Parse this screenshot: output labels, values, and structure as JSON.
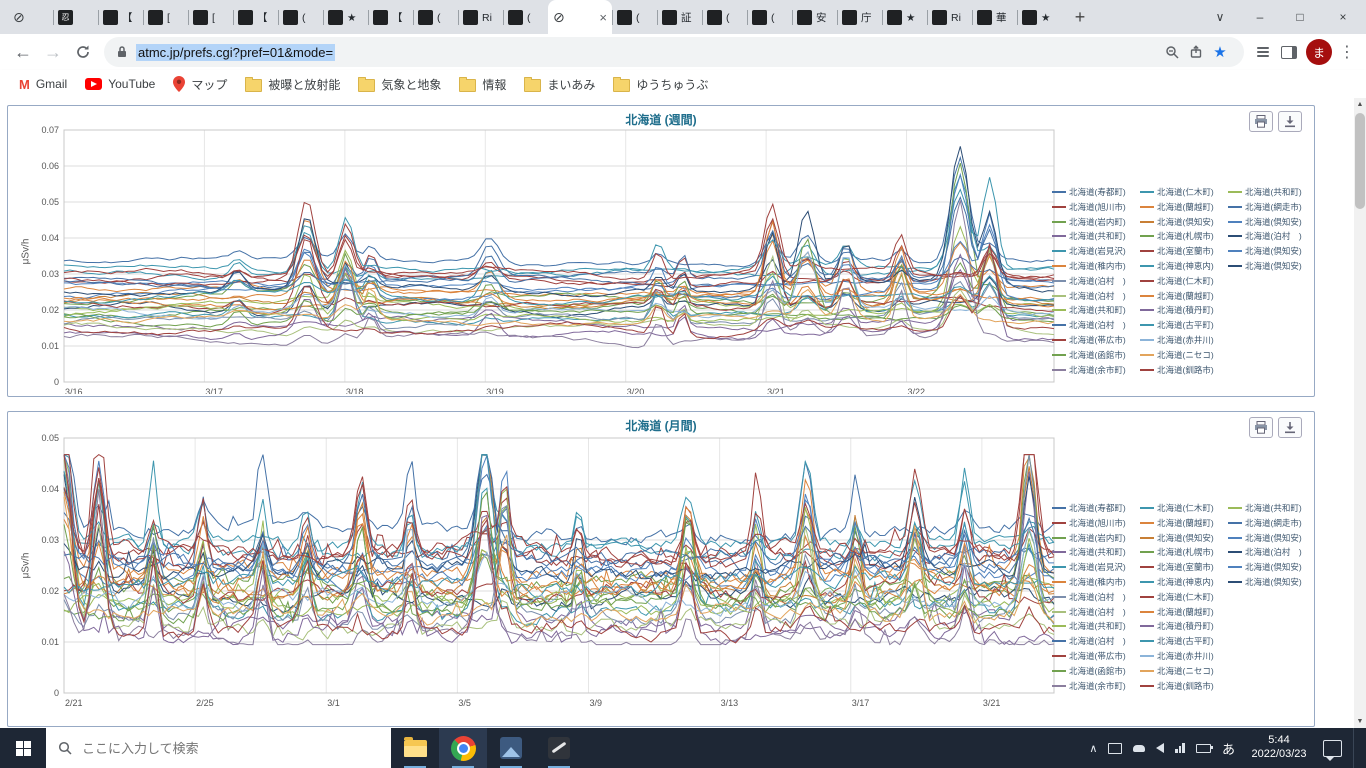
{
  "browser": {
    "active_tab_index": 12,
    "tabs": [
      {
        "icon": "slash",
        "glyph": "",
        "title": ""
      },
      {
        "icon": "dark",
        "glyph": "忍",
        "title": ""
      },
      {
        "icon": "dark",
        "glyph": "",
        "title": "【"
      },
      {
        "icon": "dark",
        "glyph": "",
        "title": "["
      },
      {
        "icon": "dark",
        "glyph": "",
        "title": "["
      },
      {
        "icon": "dark",
        "glyph": "",
        "title": "【"
      },
      {
        "icon": "dark",
        "glyph": "",
        "title": "("
      },
      {
        "icon": "dark",
        "glyph": "",
        "title": "★"
      },
      {
        "icon": "dark",
        "glyph": "",
        "title": "【"
      },
      {
        "icon": "dark",
        "glyph": "",
        "title": "("
      },
      {
        "icon": "dark",
        "glyph": "",
        "title": "Ri"
      },
      {
        "icon": "dark",
        "glyph": "",
        "title": "("
      },
      {
        "icon": "slash",
        "glyph": "",
        "title": ""
      },
      {
        "icon": "dark",
        "glyph": "",
        "title": "("
      },
      {
        "icon": "dark",
        "glyph": "",
        "title": "証"
      },
      {
        "icon": "dark",
        "glyph": "",
        "title": "("
      },
      {
        "icon": "dark",
        "glyph": "",
        "title": "("
      },
      {
        "icon": "dark",
        "glyph": "",
        "title": "安"
      },
      {
        "icon": "dark",
        "glyph": "",
        "title": "庁"
      },
      {
        "icon": "dark",
        "glyph": "",
        "title": "★"
      },
      {
        "icon": "dark",
        "glyph": "",
        "title": "Ri"
      },
      {
        "icon": "dark",
        "glyph": "",
        "title": "華"
      },
      {
        "icon": "dark",
        "glyph": "",
        "title": "★"
      }
    ],
    "window_controls": {
      "tab_search": "∨",
      "new_tab": "+",
      "minimize": "–",
      "maximize": "□",
      "close": "×"
    },
    "nav": {
      "back": "←",
      "forward": "→",
      "url": "atmc.jp/prefs.cgi?pref=01&mode=",
      "star": "★",
      "menu": "⋮",
      "avatar": "ま"
    },
    "bookmarks": [
      {
        "label": "Gmail",
        "icon": "gmail"
      },
      {
        "label": "YouTube",
        "icon": "youtube"
      },
      {
        "label": "マップ",
        "icon": "maps-pin"
      },
      {
        "label": "被曝と放射能",
        "icon": "folder"
      },
      {
        "label": "気象と地象",
        "icon": "folder"
      },
      {
        "label": "情報",
        "icon": "folder"
      },
      {
        "label": "まいあみ",
        "icon": "folder"
      },
      {
        "label": "ゆうちゅうぶ",
        "icon": "folder"
      }
    ]
  },
  "chart_data": [
    {
      "type": "line",
      "title": "北海道 (週間)",
      "ylabel": "μSv/h",
      "ylim": [
        0,
        0.07
      ],
      "yticks": [
        "0",
        "0.01",
        "0.02",
        "0.03",
        "0.04",
        "0.05",
        "0.06",
        "0.07"
      ],
      "xticks": [
        "3/16",
        "3/17",
        "3/18",
        "3/19",
        "3/20",
        "3/21",
        "3/22"
      ],
      "xtick_days": [
        0,
        1,
        2,
        3,
        4,
        5,
        6
      ],
      "days_total": 7.05,
      "grid": true,
      "legend_position": "right",
      "spikes": [
        [
          0.175,
          0.01,
          0.004
        ],
        [
          0.245,
          0.012,
          0.016
        ],
        [
          0.285,
          0.01,
          0.014
        ],
        [
          0.31,
          0.008,
          0.008
        ],
        [
          0.43,
          0.012,
          0.007
        ],
        [
          0.6,
          0.008,
          0.007
        ],
        [
          0.625,
          0.006,
          0.006
        ],
        [
          0.715,
          0.01,
          0.022
        ],
        [
          0.75,
          0.012,
          0.016
        ],
        [
          0.79,
          0.01,
          0.012
        ],
        [
          0.845,
          0.008,
          0.01
        ],
        [
          0.905,
          0.013,
          0.03
        ],
        [
          0.935,
          0.01,
          0.02
        ]
      ],
      "series": [
        {
          "name": "北海道(寿都町)",
          "color": "#4572A7",
          "base": 0.0335
        },
        {
          "name": "北海道(仁木町)",
          "color": "#3D96AE",
          "base": 0.03
        },
        {
          "name": "北海道(共和町)",
          "color": "#9BBB59",
          "base": 0.021
        },
        {
          "name": "北海道(旭川市)",
          "color": "#A0423F",
          "base": 0.029
        },
        {
          "name": "北海道(蘭越町)",
          "color": "#DB843D",
          "base": 0.0255
        },
        {
          "name": "北海道(網走市)",
          "color": "#4572A7",
          "base": 0.0275
        },
        {
          "name": "北海道(岩内町)",
          "color": "#71A14F",
          "base": 0.0195
        },
        {
          "name": "北海道(倶知安)",
          "color": "#C87F35",
          "base": 0.0225
        },
        {
          "name": "北海道(倶知安)",
          "color": "#4F81BD",
          "base": 0.0265
        },
        {
          "name": "北海道(共和町)",
          "color": "#80699B",
          "base": 0.016
        },
        {
          "name": "北海道(札幌市)",
          "color": "#71A14F",
          "base": 0.023
        },
        {
          "name": "北海道(泊村　)",
          "color": "#2C4D75",
          "base": 0.0205
        },
        {
          "name": "北海道(岩見沢)",
          "color": "#3D96AE",
          "base": 0.031
        },
        {
          "name": "北海道(室蘭市)",
          "color": "#A0423F",
          "base": 0.0285
        },
        {
          "name": "北海道(倶知安)",
          "color": "#4F81BD",
          "base": 0.0245
        },
        {
          "name": "北海道(稚内市)",
          "color": "#DB843D",
          "base": 0.022
        },
        {
          "name": "北海道(神恵内)",
          "color": "#3D96AE",
          "base": 0.018
        },
        {
          "name": "北海道(倶知安)",
          "color": "#2C4D75",
          "base": 0.026
        },
        {
          "name": "北海道(泊村　)",
          "color": "#7C8FAD",
          "base": 0.017
        },
        {
          "name": "北海道(仁木町)",
          "color": "#A0423F",
          "base": 0.0215
        },
        {
          "name": "北海道(泊村　)",
          "color": "#A8C07C",
          "base": 0.015
        },
        {
          "name": "北海道(蘭越町)",
          "color": "#DB843D",
          "base": 0.024
        },
        {
          "name": "北海道(共和町)",
          "color": "#9BBB59",
          "base": 0.019
        },
        {
          "name": "北海道(積丹町)",
          "color": "#80699B",
          "base": 0.013
        },
        {
          "name": "北海道(泊村　)",
          "color": "#4572A7",
          "base": 0.028
        },
        {
          "name": "北海道(古平町)",
          "color": "#3D96AE",
          "base": 0.0235
        },
        {
          "name": "北海道(帯広市)",
          "color": "#A0423F",
          "base": 0.03
        },
        {
          "name": "北海道(赤井川)",
          "color": "#8CB4D9",
          "base": 0.02
        },
        {
          "name": "北海道(函館市)",
          "color": "#71A14F",
          "base": 0.0185
        },
        {
          "name": "北海道(ニセコ)",
          "color": "#E2A45C",
          "base": 0.0175
        },
        {
          "name": "北海道(余市町)",
          "color": "#8B7E9E",
          "base": 0.0115
        },
        {
          "name": "北海道(釧路市)",
          "color": "#A0423F",
          "base": 0.0145
        }
      ]
    },
    {
      "type": "line",
      "title": "北海道 (月間)",
      "ylabel": "μSv/h",
      "ylim": [
        0,
        0.05
      ],
      "yticks": [
        "0",
        "0.01",
        "0.02",
        "0.03",
        "0.04",
        "0.05"
      ],
      "xticks": [
        "2/21",
        "2/25",
        "3/1",
        "3/5",
        "3/9",
        "3/13",
        "3/17",
        "3/21"
      ],
      "xtick_days": [
        0,
        4,
        8,
        12,
        16,
        20,
        24,
        28
      ],
      "days_total": 30.2,
      "grid": true,
      "legend_position": "right",
      "spikes": [
        [
          0.0,
          0.01,
          0.026
        ],
        [
          0.035,
          0.008,
          0.022
        ],
        [
          0.09,
          0.006,
          0.012
        ],
        [
          0.14,
          0.006,
          0.01
        ],
        [
          0.2,
          0.006,
          0.012
        ],
        [
          0.245,
          0.006,
          0.01
        ],
        [
          0.3,
          0.008,
          0.014
        ],
        [
          0.35,
          0.006,
          0.012
        ],
        [
          0.425,
          0.01,
          0.026
        ],
        [
          0.445,
          0.007,
          0.022
        ],
        [
          0.52,
          0.005,
          0.008
        ],
        [
          0.63,
          0.008,
          0.014
        ],
        [
          0.7,
          0.006,
          0.012
        ],
        [
          0.75,
          0.008,
          0.016
        ],
        [
          0.8,
          0.006,
          0.012
        ],
        [
          0.86,
          0.008,
          0.014
        ],
        [
          0.91,
          0.006,
          0.012
        ],
        [
          0.975,
          0.009,
          0.028
        ]
      ],
      "series": [
        {
          "name": "北海道(寿都町)",
          "color": "#4572A7",
          "base": 0.0315
        },
        {
          "name": "北海道(仁木町)",
          "color": "#3D96AE",
          "base": 0.028
        },
        {
          "name": "北海道(共和町)",
          "color": "#9BBB59",
          "base": 0.019
        },
        {
          "name": "北海道(旭川市)",
          "color": "#A0423F",
          "base": 0.027
        },
        {
          "name": "北海道(蘭越町)",
          "color": "#DB843D",
          "base": 0.0235
        },
        {
          "name": "北海道(網走市)",
          "color": "#4572A7",
          "base": 0.0255
        },
        {
          "name": "北海道(岩内町)",
          "color": "#71A14F",
          "base": 0.0175
        },
        {
          "name": "北海道(倶知安)",
          "color": "#C87F35",
          "base": 0.0205
        },
        {
          "name": "北海道(倶知安)",
          "color": "#4F81BD",
          "base": 0.0245
        },
        {
          "name": "北海道(共和町)",
          "color": "#80699B",
          "base": 0.014
        },
        {
          "name": "北海道(札幌市)",
          "color": "#71A14F",
          "base": 0.021
        },
        {
          "name": "北海道(泊村　)",
          "color": "#2C4D75",
          "base": 0.0185
        },
        {
          "name": "北海道(岩見沢)",
          "color": "#3D96AE",
          "base": 0.029
        },
        {
          "name": "北海道(室蘭市)",
          "color": "#A0423F",
          "base": 0.0265
        },
        {
          "name": "北海道(倶知安)",
          "color": "#4F81BD",
          "base": 0.0225
        },
        {
          "name": "北海道(稚内市)",
          "color": "#DB843D",
          "base": 0.02
        },
        {
          "name": "北海道(神恵内)",
          "color": "#3D96AE",
          "base": 0.016
        },
        {
          "name": "北海道(倶知安)",
          "color": "#2C4D75",
          "base": 0.024
        },
        {
          "name": "北海道(泊村　)",
          "color": "#7C8FAD",
          "base": 0.015
        },
        {
          "name": "北海道(仁木町)",
          "color": "#A0423F",
          "base": 0.0195
        },
        {
          "name": "北海道(泊村　)",
          "color": "#A8C07C",
          "base": 0.013
        },
        {
          "name": "北海道(蘭越町)",
          "color": "#DB843D",
          "base": 0.022
        },
        {
          "name": "北海道(共和町)",
          "color": "#9BBB59",
          "base": 0.017
        },
        {
          "name": "北海道(積丹町)",
          "color": "#80699B",
          "base": 0.0115
        },
        {
          "name": "北海道(泊村　)",
          "color": "#4572A7",
          "base": 0.026
        },
        {
          "name": "北海道(古平町)",
          "color": "#3D96AE",
          "base": 0.0215
        },
        {
          "name": "北海道(帯広市)",
          "color": "#A0423F",
          "base": 0.028
        },
        {
          "name": "北海道(赤井川)",
          "color": "#8CB4D9",
          "base": 0.018
        },
        {
          "name": "北海道(函館市)",
          "color": "#71A14F",
          "base": 0.0165
        },
        {
          "name": "北海道(ニセコ)",
          "color": "#E2A45C",
          "base": 0.0155
        },
        {
          "name": "北海道(余市町)",
          "color": "#8B7E9E",
          "base": 0.0105
        },
        {
          "name": "北海道(釧路市)",
          "color": "#A0423F",
          "base": 0.0125
        }
      ]
    }
  ],
  "taskbar": {
    "search_placeholder": "ここに入力して検索",
    "ime": "あ",
    "time": "5:44",
    "date": "2022/03/23"
  }
}
